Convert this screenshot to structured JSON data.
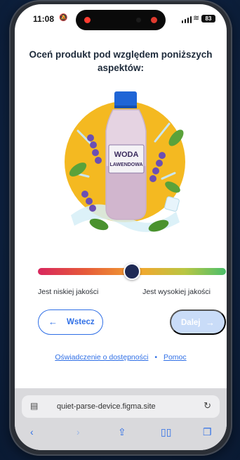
{
  "status": {
    "time": "11:08",
    "battery": "83"
  },
  "question": "Oceń produkt pod względem poniższych aspektów:",
  "product": {
    "label_line1": "WODA",
    "label_line2": "LAWENDOWA"
  },
  "rating": {
    "level": 0.5,
    "low_label": "Jest niskiej jakości",
    "high_label": "Jest wysokiej jakości"
  },
  "buttons": {
    "back_label": "Wstecz",
    "next_label": "Dalej"
  },
  "footer": {
    "accessibility_link": "Oświadczenie o dostępności",
    "separator": "•",
    "help_link": "Pomoc"
  },
  "browser": {
    "url": "quiet-parse-device.figma.site"
  },
  "icons": {
    "back": "arrow-left-icon",
    "next": "arrow-right-icon",
    "reload": "reload-icon",
    "share": "share-icon",
    "bookmarks": "book-icon",
    "tabs": "tabs-icon"
  },
  "colors": {
    "accent": "#2f6fe6",
    "thumb": "#1f2a55",
    "gradient_start": "#d8275e",
    "gradient_end": "#4bbf6b"
  }
}
